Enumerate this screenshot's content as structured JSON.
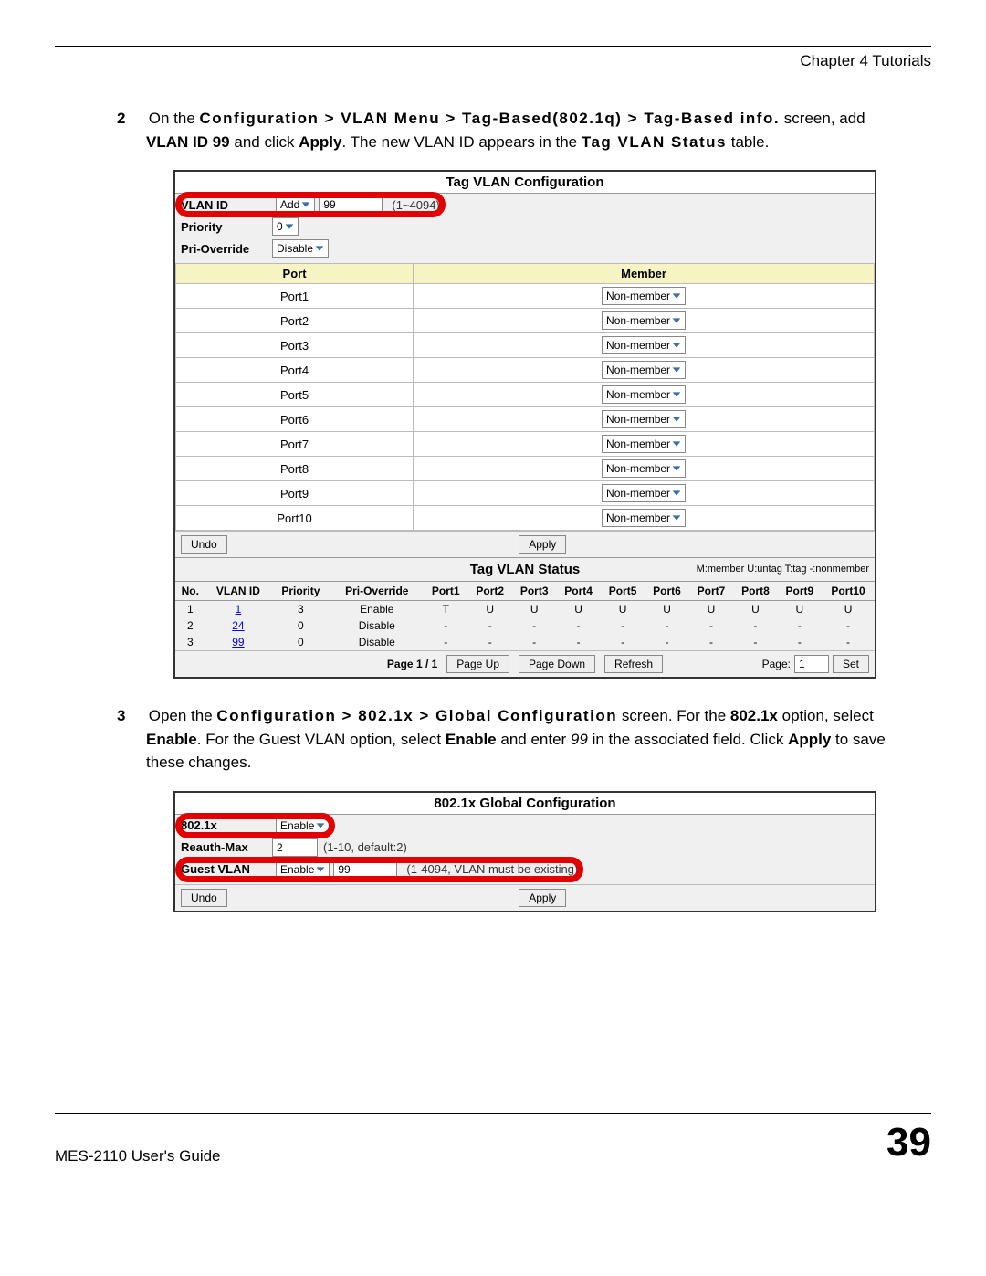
{
  "header": {
    "chapter": "Chapter 4 Tutorials"
  },
  "step2": {
    "num": "2",
    "text_pre": "On the ",
    "path": "Configuration > VLAN Menu > Tag-Based(802.1q) > Tag-Based info.",
    "mid1": " screen, add ",
    "bold1": "VLAN ID 99",
    "mid2": " and click ",
    "bold2": "Apply",
    "mid3": ". The new VLAN ID appears in the ",
    "bold3": "Tag VLAN Status",
    "tail": " table."
  },
  "panel1": {
    "title": "Tag VLAN Configuration",
    "labels": {
      "vlan_id": "VLAN ID",
      "priority": "Priority",
      "pri_override": "Pri-Override"
    },
    "vlan_action": "Add",
    "vlan_value": "99",
    "vlan_range": "(1~4094)",
    "priority_value": "0",
    "pri_override_value": "Disable",
    "port_header": "Port",
    "member_header": "Member",
    "ports": [
      "Port1",
      "Port2",
      "Port3",
      "Port4",
      "Port5",
      "Port6",
      "Port7",
      "Port8",
      "Port9",
      "Port10"
    ],
    "member_value": "Non-member",
    "undo": "Undo",
    "apply": "Apply",
    "status_title": "Tag VLAN Status",
    "legend": "M:member  U:untag  T:tag  -:nonmember",
    "status_headers": [
      "No.",
      "VLAN ID",
      "Priority",
      "Pri-Override",
      "Port1",
      "Port2",
      "Port3",
      "Port4",
      "Port5",
      "Port6",
      "Port7",
      "Port8",
      "Port9",
      "Port10"
    ],
    "status_rows": [
      {
        "no": "1",
        "vlan": "1",
        "prio": "3",
        "ovr": "Enable",
        "p": [
          "T",
          "U",
          "U",
          "U",
          "U",
          "U",
          "U",
          "U",
          "U",
          "U"
        ]
      },
      {
        "no": "2",
        "vlan": "24",
        "prio": "0",
        "ovr": "Disable",
        "p": [
          "-",
          "-",
          "-",
          "-",
          "-",
          "-",
          "-",
          "-",
          "-",
          "-"
        ]
      },
      {
        "no": "3",
        "vlan": "99",
        "prio": "0",
        "ovr": "Disable",
        "p": [
          "-",
          "-",
          "-",
          "-",
          "-",
          "-",
          "-",
          "-",
          "-",
          "-"
        ]
      }
    ],
    "pager": {
      "page_info": "Page 1 / 1",
      "page_up": "Page Up",
      "page_down": "Page Down",
      "refresh": "Refresh",
      "page_label": "Page:",
      "page_value": "1",
      "set": "Set"
    }
  },
  "step3": {
    "num": "3",
    "text_pre": "Open the ",
    "path": "Configuration > 802.1x > Global Configuration",
    "mid1": " screen. For the ",
    "bold1": "802.1x",
    "mid2": " option, select ",
    "bold2": "Enable",
    "mid3": ". For the Guest VLAN option, select ",
    "bold3": "Enable",
    "mid4": " and enter ",
    "ital": "99",
    "mid5": " in the associated field. Click ",
    "bold4": "Apply",
    "tail": " to save these changes."
  },
  "panel2": {
    "title": "802.1x Global Configuration",
    "labels": {
      "dot1x": "802.1x",
      "reauth": "Reauth-Max",
      "guest": "Guest VLAN"
    },
    "dot1x_value": "Enable",
    "reauth_value": "2",
    "reauth_hint": "(1-10, default:2)",
    "guest_sel": "Enable",
    "guest_value": "99",
    "guest_hint": "(1-4094, VLAN must be existing)",
    "undo": "Undo",
    "apply": "Apply"
  },
  "footer": {
    "guide": "MES-2110 User's Guide",
    "page": "39"
  }
}
